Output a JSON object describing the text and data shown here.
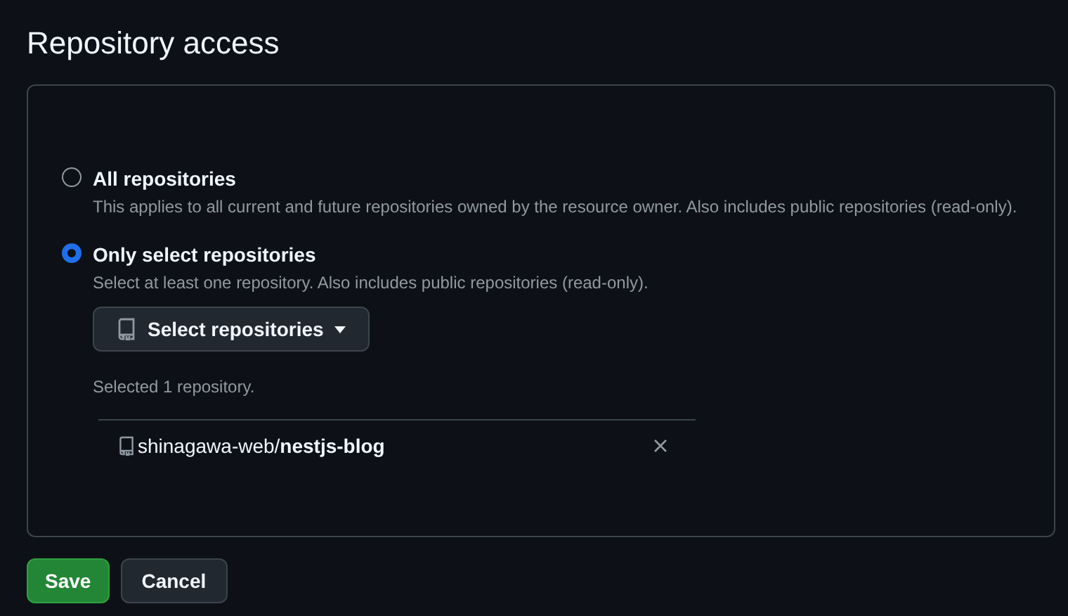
{
  "title": "Repository access",
  "options": [
    {
      "label": "All repositories",
      "description": "This applies to all current and future repositories owned by the resource owner. Also includes public repositories (read-only).",
      "selected": false
    },
    {
      "label": "Only select repositories",
      "description": "Select at least one repository. Also includes public repositories (read-only).",
      "selected": true
    }
  ],
  "picker": {
    "label": "Select repositories",
    "summary": "Selected 1 repository.",
    "repositories": [
      "shinagawa-web/**nestjs-blog**"
    ]
  },
  "buttons": [
    {
      "label": "Save",
      "kind": "primary"
    },
    {
      "label": "Cancel",
      "kind": "secondary"
    }
  ]
}
